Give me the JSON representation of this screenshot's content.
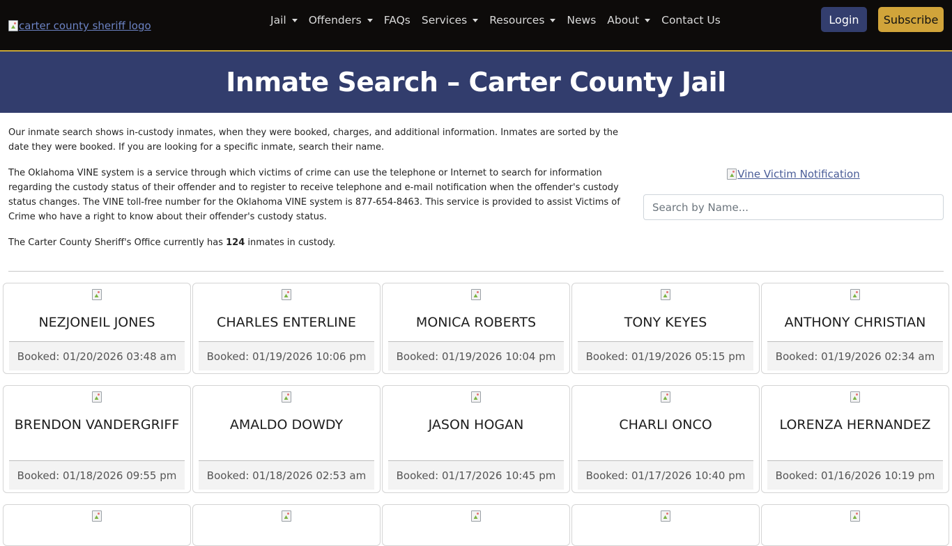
{
  "nav": {
    "logo_alt": "carter county sheriff logo",
    "items": [
      {
        "label": "Jail",
        "dropdown": true
      },
      {
        "label": "Offenders",
        "dropdown": true
      },
      {
        "label": "FAQs",
        "dropdown": false
      },
      {
        "label": "Services",
        "dropdown": true
      },
      {
        "label": "Resources",
        "dropdown": true
      },
      {
        "label": "News",
        "dropdown": false
      },
      {
        "label": "About",
        "dropdown": true
      },
      {
        "label": "Contact Us",
        "dropdown": false
      }
    ],
    "login_label": "Login",
    "subscribe_label": "Subscribe"
  },
  "hero": {
    "title": "Inmate Search – Carter County Jail"
  },
  "intro": {
    "p1": "Our inmate search shows in-custody inmates, when they were booked, charges, and additional information. Inmates are sorted by the date they were booked. If you are looking for a specific inmate, search their name.",
    "p2": "The Oklahoma VINE system is a service through which victims of crime can use the telephone or Internet to search for information regarding the custody status of their offender and to register to receive telephone and e-mail notification when the offender's custody status changes. The VINE toll-free number for the Oklahoma VINE system is 877-654-8463. This service is provided to assist Victims of Crime who have a right to know about their offender's custody status.",
    "count_prefix": "The Carter County Sheriff's Office currently has ",
    "count": "124",
    "count_suffix": " inmates in custody."
  },
  "vine": {
    "alt": "Vine Victim Notification"
  },
  "search": {
    "placeholder": "Search by Name..."
  },
  "inmates": [
    {
      "name": "NEZJONEIL JONES",
      "booked": "Booked: 01/20/2026 03:48 am"
    },
    {
      "name": "CHARLES ENTERLINE",
      "booked": "Booked: 01/19/2026 10:06 pm"
    },
    {
      "name": "MONICA ROBERTS",
      "booked": "Booked: 01/19/2026 10:04 pm"
    },
    {
      "name": "TONY KEYES",
      "booked": "Booked: 01/19/2026 05:15 pm"
    },
    {
      "name": "ANTHONY CHRISTIAN",
      "booked": "Booked: 01/19/2026 02:34 am"
    },
    {
      "name": "BRENDON VANDERGRIFF",
      "booked": "Booked: 01/18/2026 09:55 pm"
    },
    {
      "name": "AMALDO DOWDY",
      "booked": "Booked: 01/18/2026 02:53 am"
    },
    {
      "name": "JASON HOGAN",
      "booked": "Booked: 01/17/2026 10:45 pm"
    },
    {
      "name": "CHARLI ONCO",
      "booked": "Booked: 01/17/2026 10:40 pm"
    },
    {
      "name": "LORENZA HERNANDEZ",
      "booked": "Booked: 01/16/2026 10:19 pm"
    }
  ],
  "colors": {
    "navbar_bg": "#0d0b0a",
    "hero_bg": "#323d6d",
    "login_bg": "#333e6e",
    "subscribe_bg": "#d1a43a",
    "nav_border": "#c9a635"
  }
}
